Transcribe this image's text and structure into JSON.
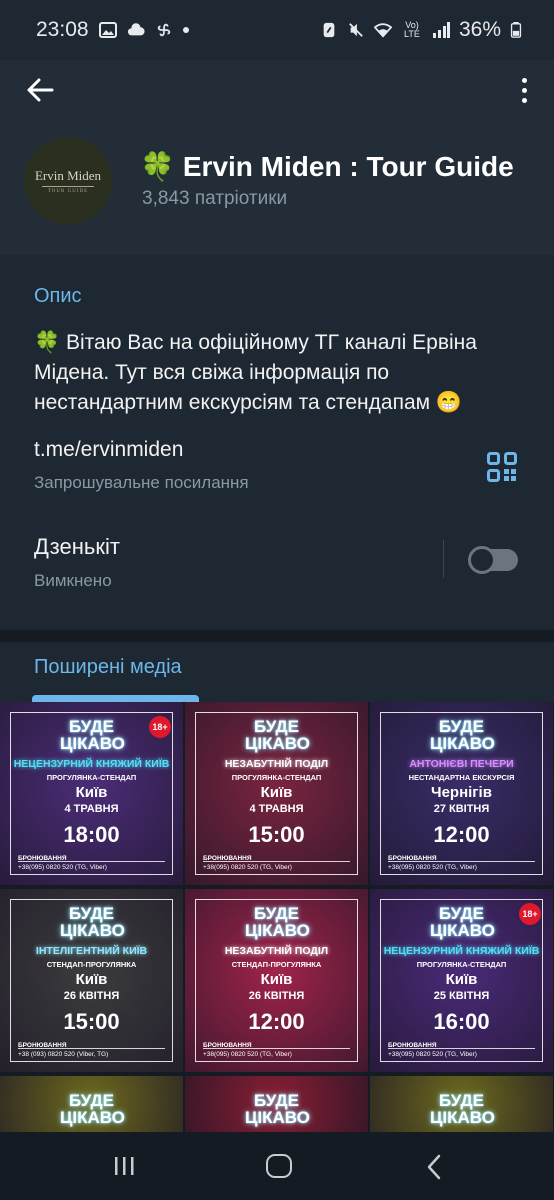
{
  "status_bar": {
    "time": "23:08",
    "battery": "36%",
    "network_label": "Vo) LTE"
  },
  "header": {
    "channel_emoji": "🍀",
    "channel_title": "Ervin Miden : Tour Guide",
    "subscribers": "3,843 патріотики",
    "avatar_name": "Ervin Miden",
    "avatar_sub": "TOUR GUIDE"
  },
  "info": {
    "section_label": "Опис",
    "description": "🍀 Вітаю Вас на офіційному ТГ каналі Ервіна Мідена. Тут вся свіжа інформація по нестандартним екскурсіям та стендапам 😁",
    "link": "t.me/ervinmiden",
    "link_sub": "Запрошувальне посилання",
    "boost_title": "Дзенькіт",
    "boost_sub": "Вимкнено",
    "boost_enabled": false
  },
  "media": {
    "tab_label": "Поширені медіа",
    "posters": [
      {
        "headline": "БУДЕ ЦІКАВО",
        "route": "НЕЦЕНЗУРНИЙ КНЯЖИЙ КИЇВ",
        "kind": "ПРОГУЛЯНКА-СТЕНДАП",
        "city": "Київ",
        "date": "4 ТРАВНЯ",
        "time": "18:00",
        "book": "БРОНЮВАННЯ",
        "phone": "+38(095) 0820 520 (TG, Viber)",
        "badge": "18+",
        "bg": "#4b2d78",
        "route_color": "#4fe0f5"
      },
      {
        "headline": "БУДЕ ЦІКАВО",
        "route": "НЕЗАБУТНІЙ ПОДІЛ",
        "kind": "ПРОГУЛЯНКА-СТЕНДАП",
        "city": "Київ",
        "date": "4 ТРАВНЯ",
        "time": "15:00",
        "book": "БРОНЮВАННЯ",
        "phone": "+38(095) 0820 520 (TG, Viber)",
        "badge": "",
        "bg": "#7a2440",
        "route_color": "#ffffff"
      },
      {
        "headline": "БУДЕ ЦІКАВО",
        "route": "АНТОНІЄВІ ПЕЧЕРИ",
        "kind": "НЕСТАНДАРТНА ЕКСКУРСІЯ",
        "city": "Чернігів",
        "date": "27 КВІТНЯ",
        "time": "12:00",
        "book": "БРОНЮВАННЯ",
        "phone": "+38(095) 0820 520 (TG, Viber)",
        "badge": "",
        "bg": "#3a2c68",
        "route_color": "#d68cff"
      },
      {
        "headline": "БУДЕ ЦІКАВО",
        "route": "ІНТЕЛІГЕНТНИЙ КИЇВ",
        "kind": "СТЕНДАП-ПРОГУЛЯНКА",
        "city": "Київ",
        "date": "26 КВІТНЯ",
        "time": "15:00",
        "book": "БРОНЮВАННЯ",
        "phone": "+38 (093) 0820 520 (Viber, TG)",
        "badge": "",
        "bg": "#3c3c3e",
        "route_color": "#8fe6ff"
      },
      {
        "headline": "БУДЕ ЦІКАВО",
        "route": "НЕЗАБУТНІЙ ПОДІЛ",
        "kind": "СТЕНДАП-ПРОГУЛЯНКА",
        "city": "Київ",
        "date": "26 КВІТНЯ",
        "time": "12:00",
        "book": "БРОНЮВАННЯ",
        "phone": "+38(095) 0820 520 (TG, Viber)",
        "badge": "",
        "bg": "#a0234a",
        "route_color": "#ffffff"
      },
      {
        "headline": "БУДЕ ЦІКАВО",
        "route": "НЕЦЕНЗУРНИЙ КНЯЖИЙ КИЇВ",
        "kind": "ПРОГУЛЯНКА-СТЕНДАП",
        "city": "Київ",
        "date": "25 КВІТНЯ",
        "time": "16:00",
        "book": "БРОНЮВАННЯ",
        "phone": "+38(095) 0820 520 (TG, Viber)",
        "badge": "18+",
        "bg": "#4a2a78",
        "route_color": "#4fe0f5"
      },
      {
        "headline": "БУДЕ ЦІКАВО",
        "bg": "#6e6a1e"
      },
      {
        "headline": "БУДЕ ЦІКАВО",
        "bg": "#8a1e34"
      },
      {
        "headline": "БУДЕ ЦІКАВО",
        "bg": "#6e6a1e"
      }
    ]
  }
}
